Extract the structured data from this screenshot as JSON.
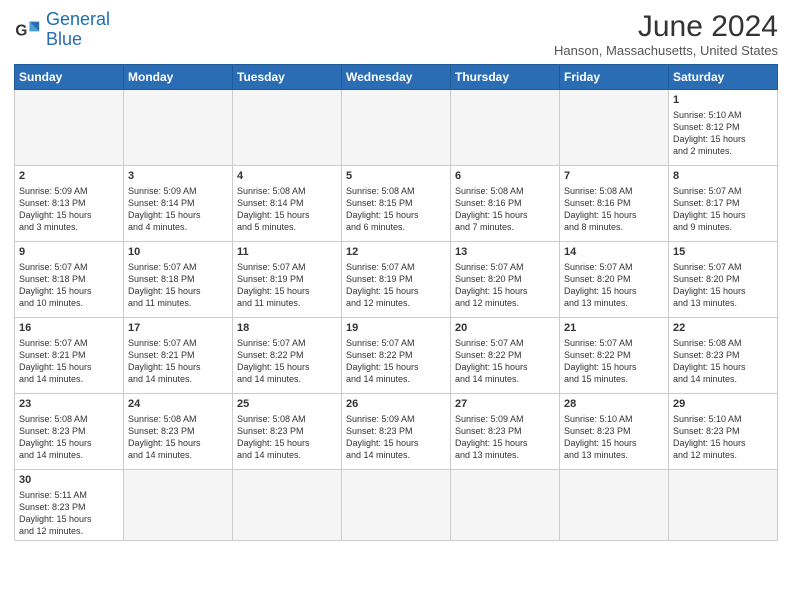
{
  "header": {
    "logo_general": "General",
    "logo_blue": "Blue",
    "main_title": "June 2024",
    "subtitle": "Hanson, Massachusetts, United States"
  },
  "days_of_week": [
    "Sunday",
    "Monday",
    "Tuesday",
    "Wednesday",
    "Thursday",
    "Friday",
    "Saturday"
  ],
  "weeks": [
    [
      {
        "day": "",
        "empty": true
      },
      {
        "day": "",
        "empty": true
      },
      {
        "day": "",
        "empty": true
      },
      {
        "day": "",
        "empty": true
      },
      {
        "day": "",
        "empty": true
      },
      {
        "day": "",
        "empty": true
      },
      {
        "day": "1",
        "info": "Sunrise: 5:10 AM\nSunset: 8:12 PM\nDaylight: 15 hours\nand 2 minutes."
      }
    ],
    [
      {
        "day": "2",
        "info": "Sunrise: 5:09 AM\nSunset: 8:13 PM\nDaylight: 15 hours\nand 3 minutes."
      },
      {
        "day": "3",
        "info": "Sunrise: 5:09 AM\nSunset: 8:14 PM\nDaylight: 15 hours\nand 4 minutes."
      },
      {
        "day": "4",
        "info": "Sunrise: 5:08 AM\nSunset: 8:14 PM\nDaylight: 15 hours\nand 5 minutes."
      },
      {
        "day": "5",
        "info": "Sunrise: 5:08 AM\nSunset: 8:15 PM\nDaylight: 15 hours\nand 6 minutes."
      },
      {
        "day": "6",
        "info": "Sunrise: 5:08 AM\nSunset: 8:16 PM\nDaylight: 15 hours\nand 7 minutes."
      },
      {
        "day": "7",
        "info": "Sunrise: 5:08 AM\nSunset: 8:16 PM\nDaylight: 15 hours\nand 8 minutes."
      },
      {
        "day": "8",
        "info": "Sunrise: 5:07 AM\nSunset: 8:17 PM\nDaylight: 15 hours\nand 9 minutes."
      }
    ],
    [
      {
        "day": "9",
        "info": "Sunrise: 5:07 AM\nSunset: 8:18 PM\nDaylight: 15 hours\nand 10 minutes."
      },
      {
        "day": "10",
        "info": "Sunrise: 5:07 AM\nSunset: 8:18 PM\nDaylight: 15 hours\nand 11 minutes."
      },
      {
        "day": "11",
        "info": "Sunrise: 5:07 AM\nSunset: 8:19 PM\nDaylight: 15 hours\nand 11 minutes."
      },
      {
        "day": "12",
        "info": "Sunrise: 5:07 AM\nSunset: 8:19 PM\nDaylight: 15 hours\nand 12 minutes."
      },
      {
        "day": "13",
        "info": "Sunrise: 5:07 AM\nSunset: 8:20 PM\nDaylight: 15 hours\nand 12 minutes."
      },
      {
        "day": "14",
        "info": "Sunrise: 5:07 AM\nSunset: 8:20 PM\nDaylight: 15 hours\nand 13 minutes."
      },
      {
        "day": "15",
        "info": "Sunrise: 5:07 AM\nSunset: 8:20 PM\nDaylight: 15 hours\nand 13 minutes."
      }
    ],
    [
      {
        "day": "16",
        "info": "Sunrise: 5:07 AM\nSunset: 8:21 PM\nDaylight: 15 hours\nand 14 minutes."
      },
      {
        "day": "17",
        "info": "Sunrise: 5:07 AM\nSunset: 8:21 PM\nDaylight: 15 hours\nand 14 minutes."
      },
      {
        "day": "18",
        "info": "Sunrise: 5:07 AM\nSunset: 8:22 PM\nDaylight: 15 hours\nand 14 minutes."
      },
      {
        "day": "19",
        "info": "Sunrise: 5:07 AM\nSunset: 8:22 PM\nDaylight: 15 hours\nand 14 minutes."
      },
      {
        "day": "20",
        "info": "Sunrise: 5:07 AM\nSunset: 8:22 PM\nDaylight: 15 hours\nand 14 minutes."
      },
      {
        "day": "21",
        "info": "Sunrise: 5:07 AM\nSunset: 8:22 PM\nDaylight: 15 hours\nand 15 minutes."
      },
      {
        "day": "22",
        "info": "Sunrise: 5:08 AM\nSunset: 8:23 PM\nDaylight: 15 hours\nand 14 minutes."
      }
    ],
    [
      {
        "day": "23",
        "info": "Sunrise: 5:08 AM\nSunset: 8:23 PM\nDaylight: 15 hours\nand 14 minutes."
      },
      {
        "day": "24",
        "info": "Sunrise: 5:08 AM\nSunset: 8:23 PM\nDaylight: 15 hours\nand 14 minutes."
      },
      {
        "day": "25",
        "info": "Sunrise: 5:08 AM\nSunset: 8:23 PM\nDaylight: 15 hours\nand 14 minutes."
      },
      {
        "day": "26",
        "info": "Sunrise: 5:09 AM\nSunset: 8:23 PM\nDaylight: 15 hours\nand 14 minutes."
      },
      {
        "day": "27",
        "info": "Sunrise: 5:09 AM\nSunset: 8:23 PM\nDaylight: 15 hours\nand 13 minutes."
      },
      {
        "day": "28",
        "info": "Sunrise: 5:10 AM\nSunset: 8:23 PM\nDaylight: 15 hours\nand 13 minutes."
      },
      {
        "day": "29",
        "info": "Sunrise: 5:10 AM\nSunset: 8:23 PM\nDaylight: 15 hours\nand 12 minutes."
      }
    ],
    [
      {
        "day": "30",
        "info": "Sunrise: 5:11 AM\nSunset: 8:23 PM\nDaylight: 15 hours\nand 12 minutes.",
        "last": true
      },
      {
        "day": "",
        "empty": true,
        "last": true
      },
      {
        "day": "",
        "empty": true,
        "last": true
      },
      {
        "day": "",
        "empty": true,
        "last": true
      },
      {
        "day": "",
        "empty": true,
        "last": true
      },
      {
        "day": "",
        "empty": true,
        "last": true
      },
      {
        "day": "",
        "empty": true,
        "last": true
      }
    ]
  ]
}
